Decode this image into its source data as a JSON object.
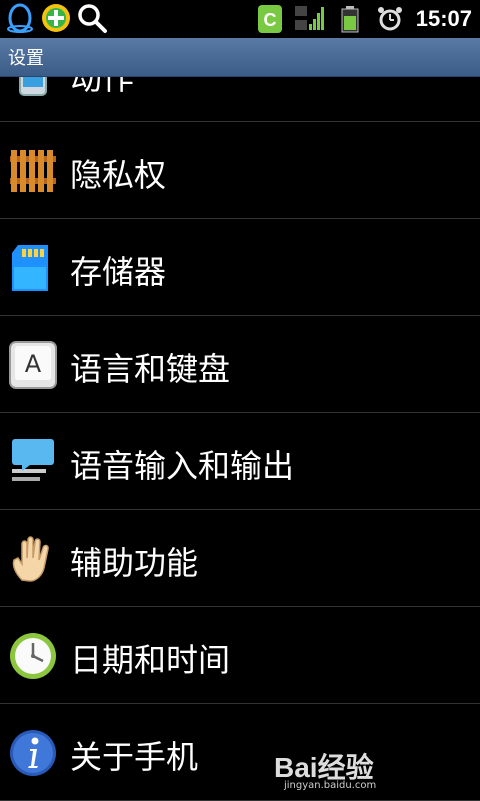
{
  "status_bar": {
    "left_icons": [
      "qq-penguin-icon",
      "add-green-icon",
      "search-icon"
    ],
    "right_icons": [
      "c-app-icon",
      "signal-3g-icon",
      "battery-icon",
      "alarm-icon"
    ],
    "time": "15:07"
  },
  "title_bar": {
    "title": "设置"
  },
  "settings": {
    "items": [
      {
        "label": "动作",
        "icon": "phone-motion-icon"
      },
      {
        "label": "隐私权",
        "icon": "fence-icon"
      },
      {
        "label": "存储器",
        "icon": "sd-card-icon"
      },
      {
        "label": "语言和键盘",
        "icon": "keyboard-key-icon"
      },
      {
        "label": "语音输入和输出",
        "icon": "monitor-speech-icon"
      },
      {
        "label": "辅助功能",
        "icon": "hand-icon"
      },
      {
        "label": "日期和时间",
        "icon": "clock-icon"
      },
      {
        "label": "关于手机",
        "icon": "info-icon"
      }
    ]
  },
  "watermark": {
    "brand": "Bai经验",
    "url": "jingyan.baidu.com"
  },
  "colors": {
    "title_bar": "#4a6a96",
    "background": "#000000",
    "divider": "#333333"
  }
}
